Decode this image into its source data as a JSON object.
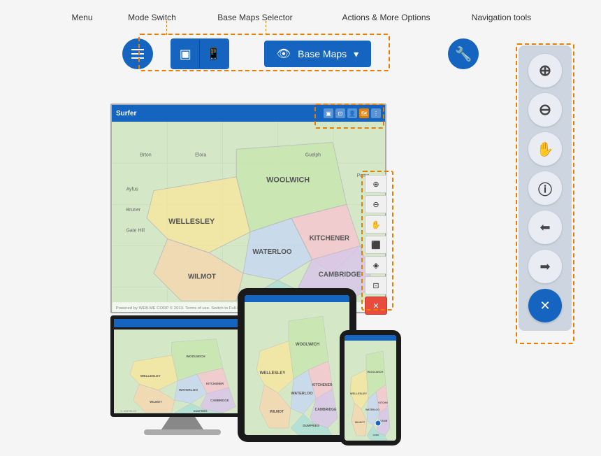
{
  "labels": {
    "menu": "Menu",
    "mode_switch": "Mode Switch",
    "base_maps_selector": "Base Maps Selector",
    "actions_more": "Actions & More Options",
    "navigation_tools": "Navigation tools"
  },
  "toolbar": {
    "base_maps_label": "Base Maps",
    "base_maps_icon": "👁",
    "chevron": "▾"
  },
  "nav_tools": {
    "zoom_in": "+",
    "zoom_out": "−",
    "pan": "✋",
    "info": "ⓘ",
    "import": "⬅",
    "export": "➡",
    "close": "✕"
  },
  "map_window": {
    "title": "Surfer",
    "region_names": [
      "WELLESLEY",
      "WOOLWICH",
      "WATERLOO",
      "KITCHENER",
      "CAMBRIDGE",
      "WILMOT",
      "DUMFRIES"
    ]
  },
  "mode_icons": {
    "desktop": "▣",
    "mobile": "⊡"
  },
  "actions_icon": "⚙"
}
